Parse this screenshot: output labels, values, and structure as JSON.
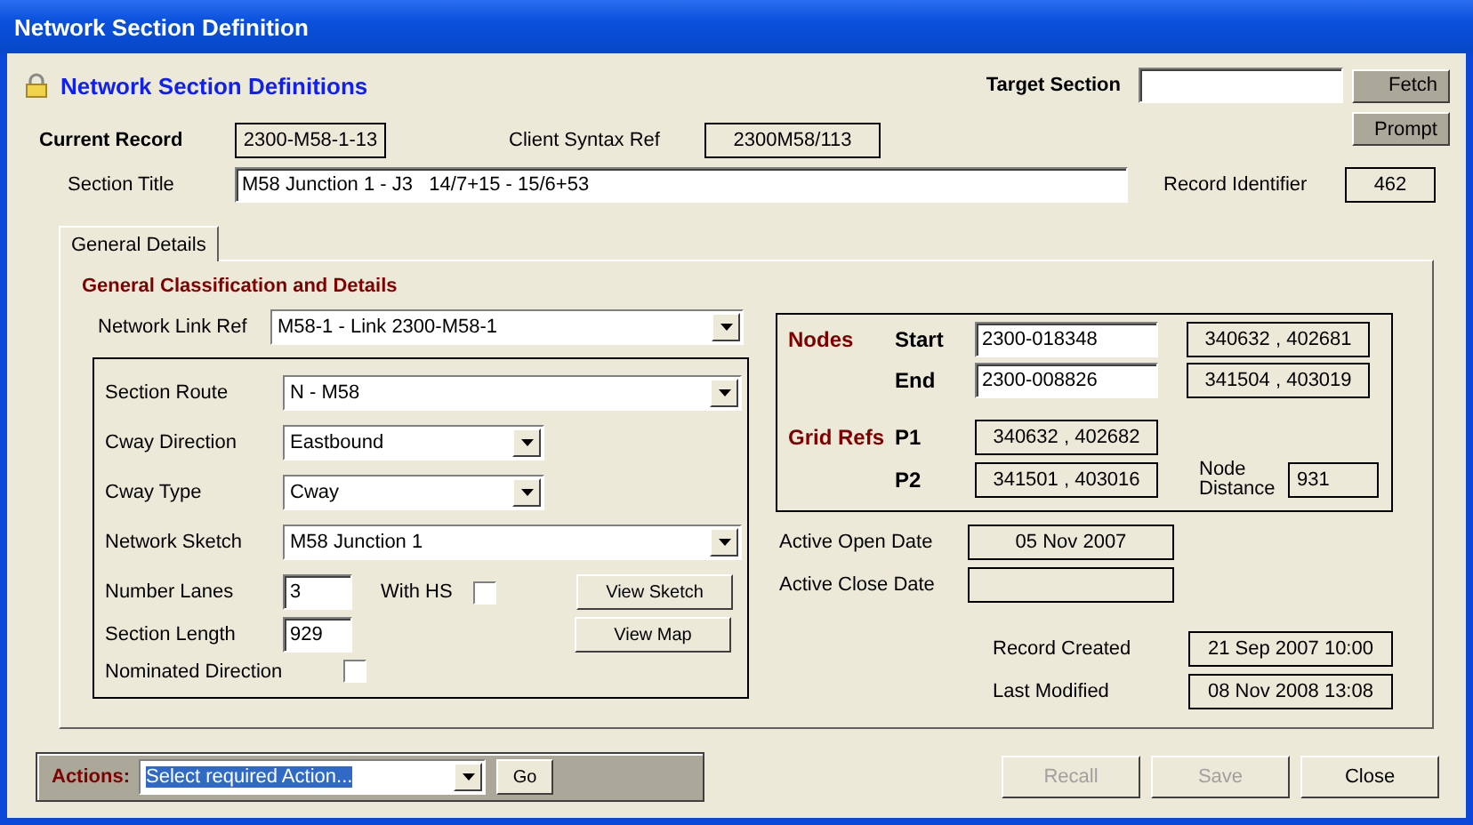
{
  "window": {
    "title": "Network Section Definition"
  },
  "header": {
    "title": "Network Section Definitions",
    "target_label": "Target Section",
    "fetch_button": "Fetch",
    "prompt_button": "Prompt"
  },
  "record": {
    "current_label": "Current Record",
    "current_value": "2300-M58-1-13",
    "client_label": "Client Syntax Ref",
    "client_value": "2300M58/113",
    "title_label": "Section Title",
    "title_value": "M58 Junction 1 - J3   14/7+15 - 15/6+53",
    "id_label": "Record Identifier",
    "id_value": "462"
  },
  "tabs": [
    {
      "label": "General Details",
      "selected": true
    }
  ],
  "classification": {
    "heading": "General Classification and Details",
    "link_ref": {
      "label": "Network Link Ref",
      "value": "M58-1 - Link 2300-M58-1"
    },
    "dropdowns": [
      {
        "kind": "long",
        "label": "Section Route",
        "value": "N - M58"
      },
      {
        "kind": "short",
        "label": "Cway Direction",
        "value": "Eastbound"
      },
      {
        "kind": "short",
        "label": "Cway Type",
        "value": "Cway"
      },
      {
        "kind": "long",
        "label": "Network Sketch",
        "value": "M58 Junction 1"
      }
    ],
    "lanes": {
      "label": "Number Lanes",
      "value": "3"
    },
    "with_hs": {
      "label": "With HS",
      "checked": false
    },
    "length": {
      "label": "Section Length",
      "value": "929"
    },
    "nominated": {
      "label": "Nominated Direction",
      "checked": false
    },
    "view_sketch_button": "View Sketch",
    "view_map_button": "View Map"
  },
  "nodes": {
    "heading": "Nodes",
    "items": [
      {
        "label": "Start",
        "node": "2300-018348",
        "coords": "340632 , 402681"
      },
      {
        "label": "End",
        "node": "2300-008826",
        "coords": "341504 , 403019"
      }
    ],
    "grid_heading": "Grid Refs",
    "grid_refs": [
      {
        "label": "P1",
        "value": "340632 , 402682"
      },
      {
        "label": "P2",
        "value": "341501 , 403016"
      }
    ],
    "distance_label": "Node Distance",
    "distance_value": "931"
  },
  "dates": {
    "open_label": "Active Open Date",
    "open_value": "05 Nov 2007",
    "close_label": "Active Close Date",
    "created_label": "Record Created",
    "created_value": "21 Sep 2007 10:00",
    "modified_label": "Last Modified",
    "modified_value": "08 Nov 2008 13:08"
  },
  "actions": {
    "label": "Actions:",
    "value": "Select required Action...",
    "highlighted": true,
    "go_button": "Go"
  },
  "buttons": [
    {
      "label": "Recall",
      "disabled": true
    },
    {
      "label": "Save",
      "disabled": true
    },
    {
      "label": "Close",
      "disabled": false
    }
  ]
}
